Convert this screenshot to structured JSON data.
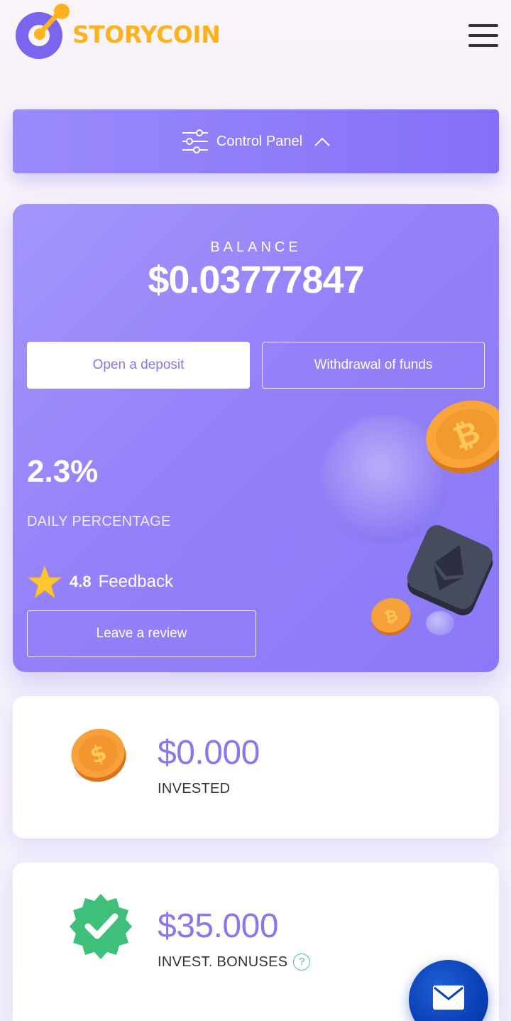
{
  "header": {
    "brand": "STORYCOIN"
  },
  "control_panel": {
    "label": "Control Panel"
  },
  "balance": {
    "label": "BALANCE",
    "value": "$0.03777847",
    "deposit_button": "Open a deposit",
    "withdraw_button": "Withdrawal of funds",
    "daily_percentage_value": "2.3%",
    "daily_percentage_label": "DAILY PERCENTAGE",
    "rating": "4.8",
    "feedback_label": "Feedback",
    "review_button": "Leave a review"
  },
  "stats": {
    "invested": {
      "value": "$0.000",
      "label": "INVESTED"
    },
    "bonuses": {
      "value": "$35.000",
      "label": "INVEST. BONUSES",
      "help": "?"
    }
  },
  "colors": {
    "accent": "#8b78f8",
    "brand": "#ffb21e",
    "fab": "#0a3fb4"
  },
  "icons": [
    "storycoin-logo-icon",
    "menu-icon",
    "sliders-icon",
    "chevron-up-icon",
    "star-icon",
    "coin-icon",
    "verified-badge-icon",
    "help-icon",
    "mail-icon"
  ]
}
